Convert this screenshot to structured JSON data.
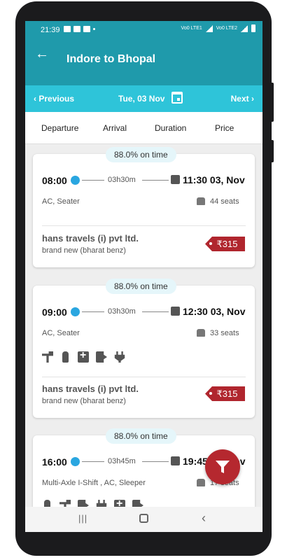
{
  "status_bar": {
    "time": "21:39",
    "network_1": "Vo0 LTE1",
    "network_2": "Vo0 LTE2"
  },
  "app_bar": {
    "back_icon": "arrow-left-icon",
    "title": "Indore to Bhopal"
  },
  "date_bar": {
    "previous": "Previous",
    "date": "Tue, 03 Nov",
    "next": "Next"
  },
  "sort_bar": {
    "departure": "Departure",
    "arrival": "Arrival",
    "duration": "Duration",
    "price": "Price"
  },
  "buses": [
    {
      "on_time": "88.0% on time",
      "departure": "08:00",
      "duration": "03h30m",
      "arrival": "11:30 03, Nov",
      "bus_type": "AC, Seater",
      "seats": "44 seats",
      "operator": "hans travels (i) pvt ltd.",
      "description": "brand new (bharat benz)",
      "price": "₹315"
    },
    {
      "on_time": "88.0% on time",
      "departure": "09:00",
      "duration": "03h30m",
      "arrival": "12:30 03, Nov",
      "bus_type": "AC, Seater",
      "seats": "33 seats",
      "amenities": [
        "hammer-icon",
        "extinguisher-icon",
        "first-aid-icon",
        "emergency-exit-icon",
        "charging-plug-icon"
      ],
      "operator": "hans travels (i) pvt ltd.",
      "description": "brand new (bharat benz)",
      "price": "₹315"
    },
    {
      "on_time": "88.0% on time",
      "departure": "16:00",
      "duration": "03h45m",
      "arrival": "19:45 03, Nov",
      "bus_type": "Multi-Axle I-Shift , AC, Sleeper",
      "seats": "17 seats"
    }
  ],
  "filter_button": {
    "icon": "filter-icon"
  },
  "colors": {
    "primary": "#1f9aab",
    "date_bar": "#2ec4d9",
    "accent": "#b0262e",
    "dot": "#2aa6e0"
  }
}
